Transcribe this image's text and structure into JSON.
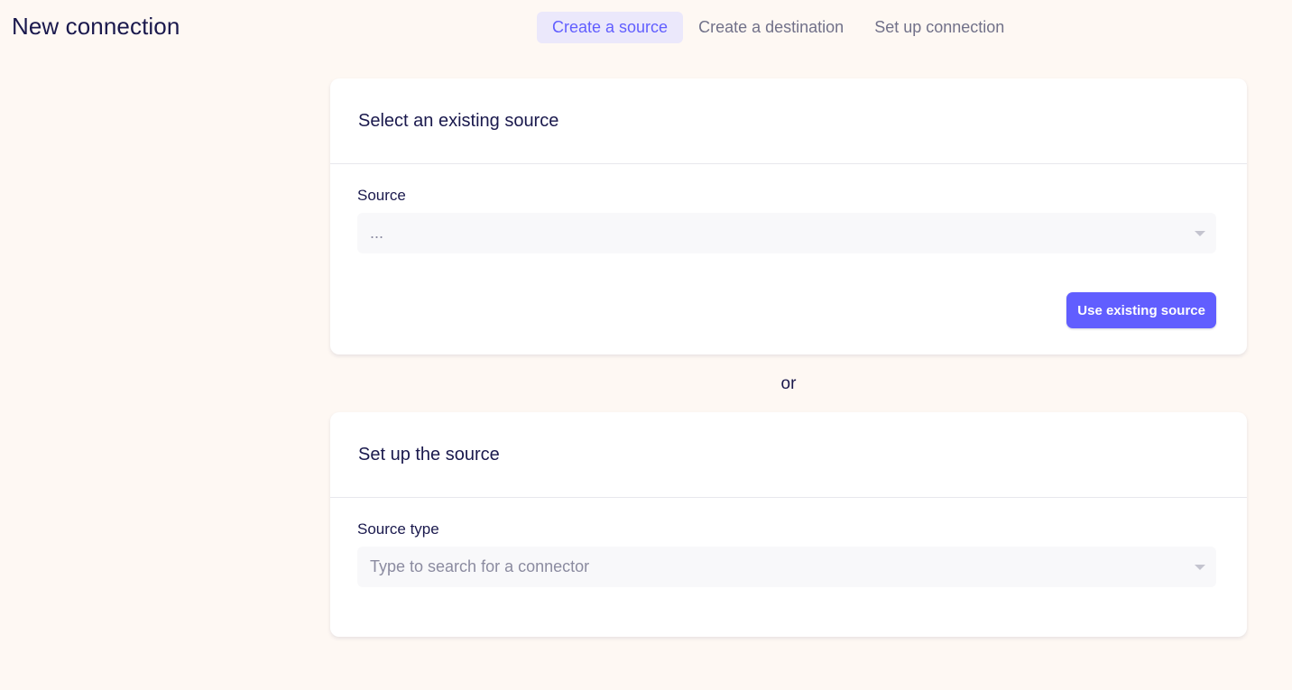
{
  "page": {
    "title": "New connection"
  },
  "steps": [
    {
      "label": "Create a source",
      "active": true
    },
    {
      "label": "Create a destination",
      "active": false
    },
    {
      "label": "Set up connection",
      "active": false
    }
  ],
  "existing_source": {
    "heading": "Select an existing source",
    "field_label": "Source",
    "select_value": "...",
    "button_label": "Use existing source"
  },
  "divider_text": "or",
  "new_source": {
    "heading": "Set up the source",
    "field_label": "Source type",
    "select_placeholder": "Type to search for a connector"
  },
  "colors": {
    "accent": "#615eff",
    "background": "#fef8f3",
    "text": "#1a194d"
  }
}
